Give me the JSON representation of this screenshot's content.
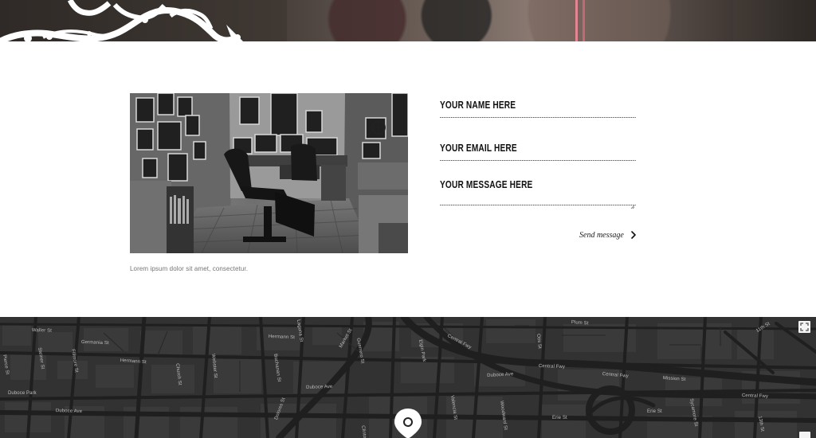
{
  "form": {
    "name_placeholder": "YOUR NAME HERE",
    "email_placeholder": "YOUR EMAIL HERE",
    "message_placeholder": "YOUR MESSAGE HERE",
    "send_label": "Send message"
  },
  "gallery": {
    "caption": "Lorem ipsum dolor sit amet, consectetur."
  },
  "map": {
    "labels": [
      "Waller St",
      "Germania St",
      "Pierce St",
      "Steiner St",
      "Fillmore St",
      "Hermann St",
      "Church St",
      "Webster St",
      "Buchanan St",
      "Laguna St",
      "Duboce Park",
      "Duboce Ave",
      "Hermann St",
      "Market St",
      "Guerrero St",
      "Duboce Ave",
      "Elgin Park",
      "Central Fwy",
      "Duboce Ave",
      "Valencia St",
      "Otis St",
      "Plum St",
      "Central Fwy",
      "Central Fwy",
      "Central Fwy",
      "Erie St",
      "Erie St",
      "Mission St",
      "Woodward St",
      "Sycamore St",
      "11th St",
      "13th St",
      "Dolores St",
      "Clinton Park"
    ]
  },
  "icons": {
    "fullscreen": "fullscreen-icon",
    "location": "map-pin-icon",
    "arrow": "chevron-right-icon"
  },
  "colors": {
    "map_background": "#323232",
    "map_road": "#1f1f1f",
    "map_block": "#414141",
    "text_primary": "#111111",
    "caption": "#747474",
    "banner_strap": "#ff8f9e"
  }
}
